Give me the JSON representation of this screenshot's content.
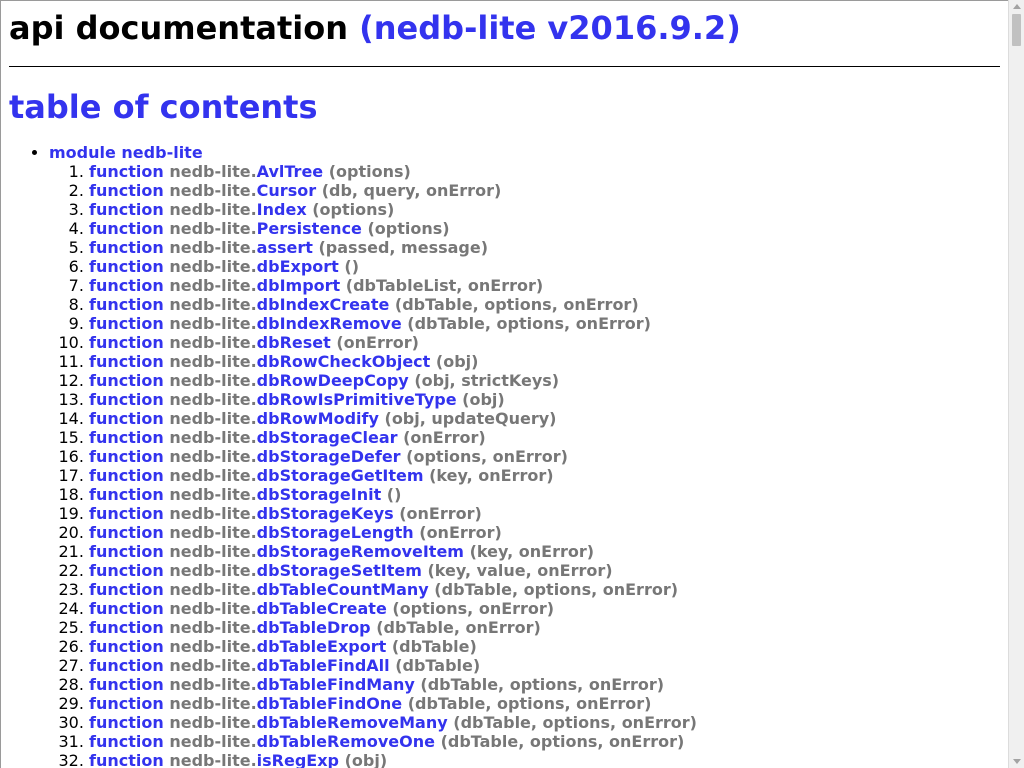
{
  "header": {
    "title": "api documentation",
    "version": "(nedb-lite v2016.9.2)"
  },
  "toc": {
    "title": "table of contents",
    "module_label": "module nedb-lite",
    "keyword": "function",
    "namespace": "nedb-lite.",
    "functions": [
      {
        "name": "AvlTree",
        "args": "(options)"
      },
      {
        "name": "Cursor",
        "args": "(db, query, onError)"
      },
      {
        "name": "Index",
        "args": "(options)"
      },
      {
        "name": "Persistence",
        "args": "(options)"
      },
      {
        "name": "assert",
        "args": "(passed, message)"
      },
      {
        "name": "dbExport",
        "args": "()"
      },
      {
        "name": "dbImport",
        "args": "(dbTableList, onError)"
      },
      {
        "name": "dbIndexCreate",
        "args": "(dbTable, options, onError)"
      },
      {
        "name": "dbIndexRemove",
        "args": "(dbTable, options, onError)"
      },
      {
        "name": "dbReset",
        "args": "(onError)"
      },
      {
        "name": "dbRowCheckObject",
        "args": "(obj)"
      },
      {
        "name": "dbRowDeepCopy",
        "args": "(obj, strictKeys)"
      },
      {
        "name": "dbRowIsPrimitiveType",
        "args": "(obj)"
      },
      {
        "name": "dbRowModify",
        "args": "(obj, updateQuery)"
      },
      {
        "name": "dbStorageClear",
        "args": "(onError)"
      },
      {
        "name": "dbStorageDefer",
        "args": "(options, onError)"
      },
      {
        "name": "dbStorageGetItem",
        "args": "(key, onError)"
      },
      {
        "name": "dbStorageInit",
        "args": "()"
      },
      {
        "name": "dbStorageKeys",
        "args": "(onError)"
      },
      {
        "name": "dbStorageLength",
        "args": "(onError)"
      },
      {
        "name": "dbStorageRemoveItem",
        "args": "(key, onError)"
      },
      {
        "name": "dbStorageSetItem",
        "args": "(key, value, onError)"
      },
      {
        "name": "dbTableCountMany",
        "args": "(dbTable, options, onError)"
      },
      {
        "name": "dbTableCreate",
        "args": "(options, onError)"
      },
      {
        "name": "dbTableDrop",
        "args": "(dbTable, onError)"
      },
      {
        "name": "dbTableExport",
        "args": "(dbTable)"
      },
      {
        "name": "dbTableFindAll",
        "args": "(dbTable)"
      },
      {
        "name": "dbTableFindMany",
        "args": "(dbTable, options, onError)"
      },
      {
        "name": "dbTableFindOne",
        "args": "(dbTable, options, onError)"
      },
      {
        "name": "dbTableRemoveMany",
        "args": "(dbTable, options, onError)"
      },
      {
        "name": "dbTableRemoveOne",
        "args": "(dbTable, options, onError)"
      },
      {
        "name": "isRegExp",
        "args": "(obj)"
      }
    ]
  },
  "colors": {
    "link": "#3333ee",
    "muted": "#777777"
  }
}
